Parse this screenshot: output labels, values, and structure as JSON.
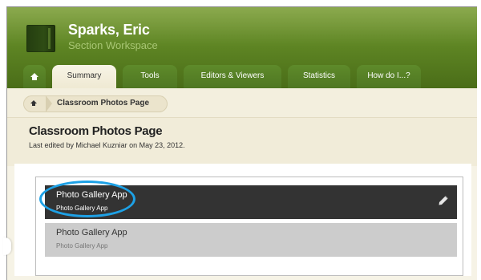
{
  "header": {
    "title": "Sparks, Eric",
    "subtitle": "Section Workspace"
  },
  "tabs": [
    {
      "label": "",
      "icon": "home-icon"
    },
    {
      "label": "Summary"
    },
    {
      "label": "Tools"
    },
    {
      "label": "Editors & Viewers"
    },
    {
      "label": "Statistics"
    },
    {
      "label": "How do I...?"
    }
  ],
  "breadcrumb": {
    "home_icon": "home-icon",
    "label": "Classroom Photos Page"
  },
  "page": {
    "title": "Classroom Photos Page",
    "meta": "Last edited by Michael Kuzniar on May 23, 2012."
  },
  "apps": [
    {
      "title": "Photo Gallery App",
      "subtitle": "Photo Gallery App"
    },
    {
      "title": "Photo Gallery App",
      "subtitle": "Photo Gallery App"
    }
  ],
  "colors": {
    "header_green": "#5f8624",
    "highlight_blue": "#1da1e6",
    "selected_row": "#333333",
    "normal_row": "#cccccc"
  }
}
